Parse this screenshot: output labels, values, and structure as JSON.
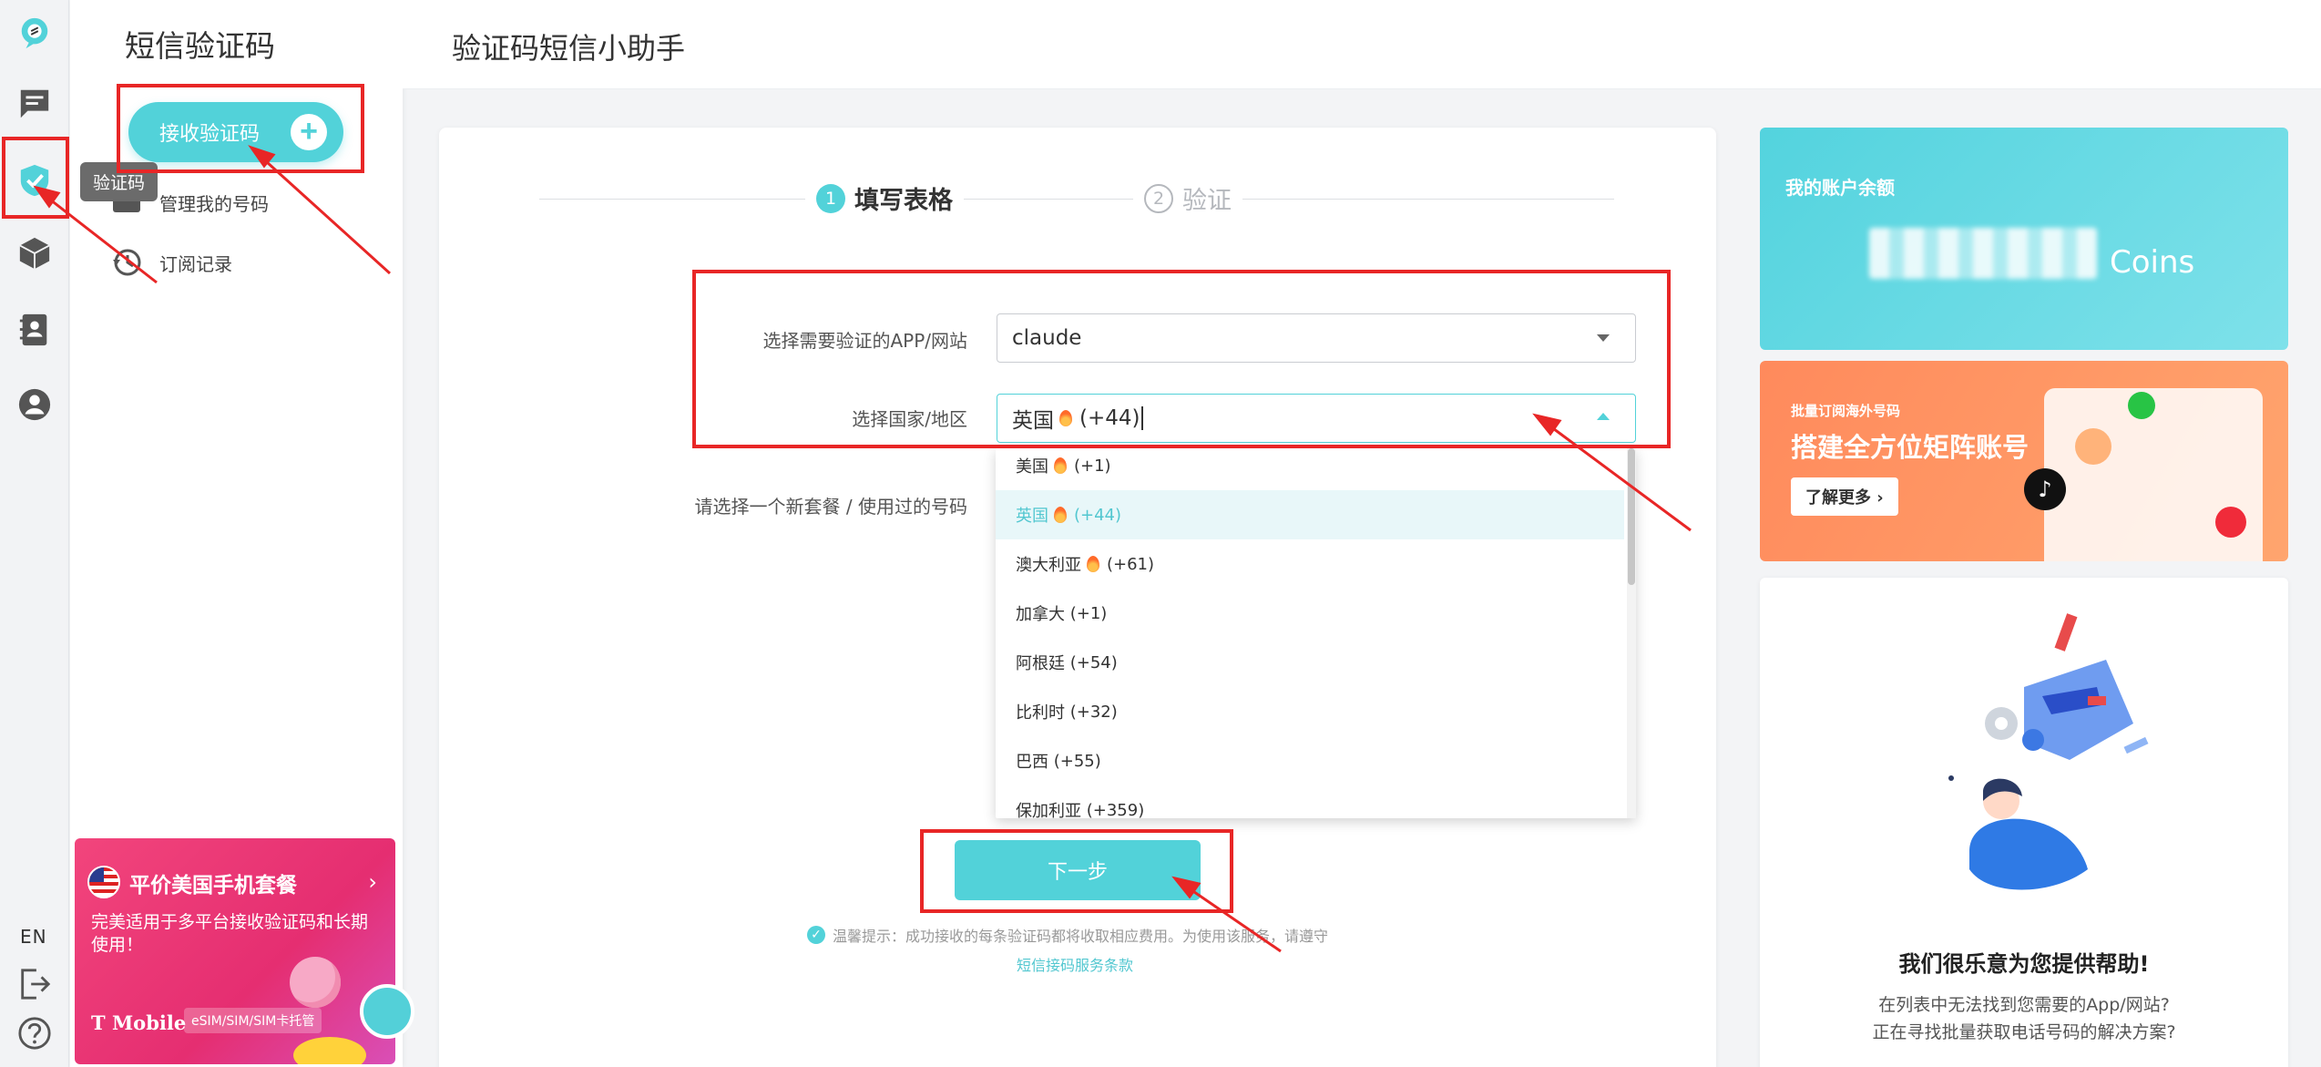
{
  "rail": {
    "tooltip": "验证码",
    "lang": "EN"
  },
  "sidebar": {
    "title": "短信验证码",
    "receive_button": "接收验证码",
    "items": [
      {
        "label": "管理我的号码"
      },
      {
        "label": "订阅记录"
      }
    ],
    "promo": {
      "title": "平价美国手机套餐",
      "text": "完美适用于多平台接收验证码和长期使用！",
      "brand": "T Mobile",
      "tag": "eSIM/SIM/SIM卡托管"
    }
  },
  "header": {
    "title": "验证码短信小助手"
  },
  "steps": [
    {
      "num": "1",
      "label": "填写表格",
      "active": true
    },
    {
      "num": "2",
      "label": "验证",
      "active": false
    }
  ],
  "form": {
    "app_label": "选择需要验证的APP/网站",
    "app_value": "claude",
    "country_label": "选择国家/地区",
    "country_value_name": "英国",
    "country_value_code": "(+44)",
    "plan_label": "请选择一个新套餐 / 使用过的号码"
  },
  "dropdown": {
    "options": [
      {
        "name": "美国",
        "hot": true,
        "code": "(+1)"
      },
      {
        "name": "英国",
        "hot": true,
        "code": "(+44)",
        "selected": true
      },
      {
        "name": "澳大利亚",
        "hot": true,
        "code": "(+61)"
      },
      {
        "name": "加拿大",
        "hot": false,
        "code": "(+1)"
      },
      {
        "name": "阿根廷",
        "hot": false,
        "code": "(+54)"
      },
      {
        "name": "比利时",
        "hot": false,
        "code": "(+32)"
      },
      {
        "name": "巴西",
        "hot": false,
        "code": "(+55)"
      },
      {
        "name": "保加利亚",
        "hot": false,
        "code": "(+359)"
      }
    ]
  },
  "actions": {
    "next": "下一步",
    "hint": "温馨提示：成功接收的每条验证码都将收取相应费用。为使用该服务，请遵守",
    "terms": "短信接码服务条款"
  },
  "balance": {
    "label": "我的账户余额",
    "unit": "Coins"
  },
  "ad": {
    "small": "批量订阅海外号码",
    "big": "搭建全方位矩阵账号",
    "button": "了解更多"
  },
  "help": {
    "title": "我们很乐意为您提供帮助!",
    "line1": "在列表中无法找到您需要的App/网站?",
    "line2": "正在寻找批量获取电话号码的解决方案?"
  },
  "colors": {
    "accent": "#52d2d9",
    "annotation": "#e82626"
  }
}
